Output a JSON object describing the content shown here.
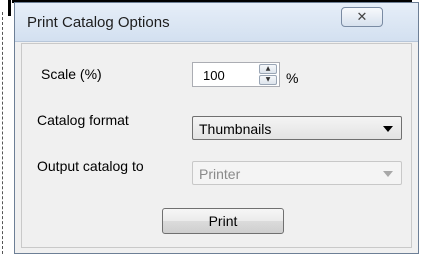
{
  "window": {
    "title": "Print Catalog Options",
    "close_glyph": "✕"
  },
  "form": {
    "scale": {
      "label": "Scale (%)",
      "value": "100",
      "unit": "%",
      "up_glyph": "▲",
      "down_glyph": "▼"
    },
    "catalog_format": {
      "label": "Catalog format",
      "selected": "Thumbnails"
    },
    "output": {
      "label": "Output catalog to",
      "selected": "Printer",
      "disabled": true
    },
    "print_label": "Print"
  },
  "colors": {
    "accent_border": "#6d7f96",
    "titlebar": "#d3e0f0",
    "dialog_bg": "#f0f0f0",
    "disabled_text": "#8a8a8a"
  }
}
